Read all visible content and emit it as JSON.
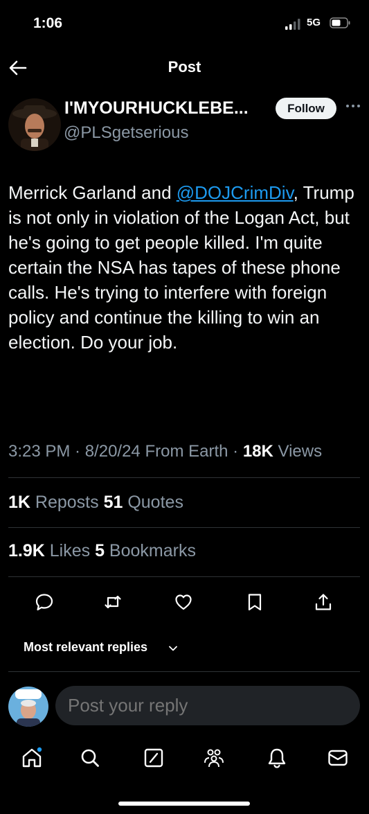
{
  "status_bar": {
    "time": "1:06",
    "network": "5G"
  },
  "header": {
    "title": "Post"
  },
  "author": {
    "display_name": "I'MYOURHUCKLEBE...",
    "handle": "@PLSgetserious",
    "follow_label": "Follow"
  },
  "tweet": {
    "text_before": "Merrick Garland and ",
    "mention": "@DOJCrimDiv",
    "text_after": ", Trump is not only in violation of the Logan Act, but he's going to get people killed. I'm quite certain the NSA has tapes of these phone calls. He's trying to interfere with foreign policy and continue the killing to win an election. Do your job."
  },
  "meta": {
    "timestamp": "3:23 PM · 8/20/24 From Earth · ",
    "views_count": "18K",
    "views_label": " Views"
  },
  "stats": {
    "reposts_count": "1K",
    "reposts_label": " Reposts ",
    "quotes_count": "51",
    "quotes_label": " Quotes",
    "likes_count": "1.9K",
    "likes_label": " Likes ",
    "bookmarks_count": "5",
    "bookmarks_label": " Bookmarks"
  },
  "actions": [
    "reply-icon",
    "repost-icon",
    "like-icon",
    "bookmark-icon",
    "share-icon"
  ],
  "replies": {
    "sort_label": "Most relevant replies"
  },
  "reply_box": {
    "placeholder": "Post your reply"
  },
  "tabbar": [
    "home-icon",
    "search-icon",
    "grok-icon",
    "communities-icon",
    "notifications-icon",
    "messages-icon"
  ],
  "colors": {
    "accent": "#1d9bf0",
    "background": "#000000",
    "secondary_text": "#8b98a5"
  }
}
